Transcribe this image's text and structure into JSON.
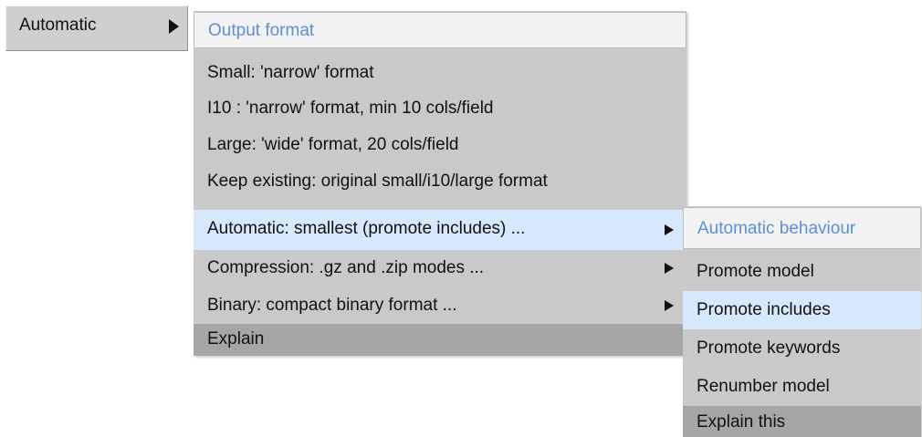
{
  "trigger": {
    "label": "Automatic",
    "arrow_icon": "triangle-right-icon"
  },
  "menu1": {
    "header": "Output format",
    "items": [
      {
        "label": "Small: 'narrow' format",
        "has_submenu": false
      },
      {
        "label": "I10  : 'narrow' format, min 10 cols/field",
        "has_submenu": false
      },
      {
        "label": "Large: 'wide' format, 20 cols/field",
        "has_submenu": false
      },
      {
        "label": "Keep existing: original small/i10/large format",
        "has_submenu": false
      },
      {
        "label": "Automatic: smallest (promote includes) ...",
        "has_submenu": true,
        "highlighted": true
      },
      {
        "label": "Compression: .gz and .zip modes ...",
        "has_submenu": true
      },
      {
        "label": "Binary: compact binary format ...",
        "has_submenu": true
      },
      {
        "label": "Explain",
        "has_submenu": false
      }
    ]
  },
  "menu2": {
    "header": "Automatic behaviour",
    "items": [
      {
        "label": "Promote model"
      },
      {
        "label": "Promote includes",
        "highlighted": true
      },
      {
        "label": "Promote keywords"
      },
      {
        "label": "Renumber model"
      },
      {
        "label": "Explain this"
      }
    ]
  },
  "colors": {
    "menu_bg": "#c9c9c9",
    "header_bg": "#f2f2f2",
    "header_text": "#5c8fd6",
    "highlight_bg": "#d6e8fb",
    "explain_bg": "#a6a6a6"
  }
}
